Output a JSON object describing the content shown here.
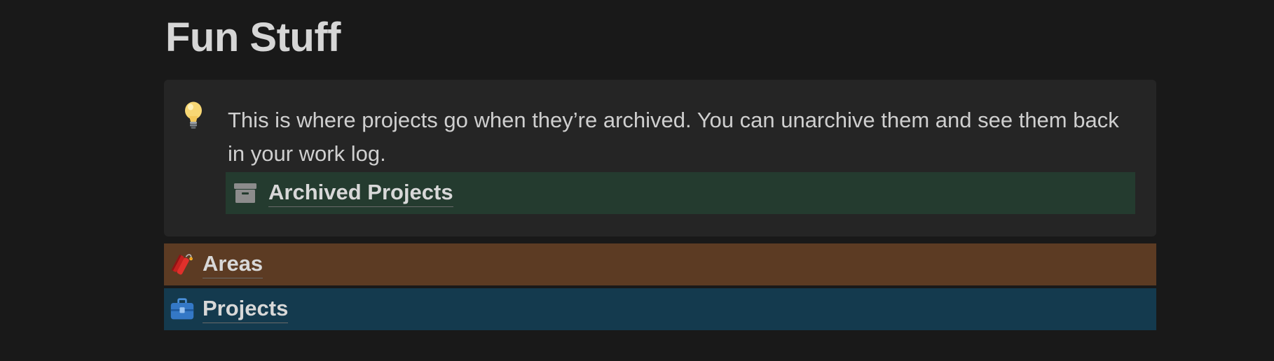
{
  "page": {
    "title": "Fun Stuff"
  },
  "callout": {
    "icon": "lightbulb-icon",
    "text": "This is where projects go when they’re archived. You can unarchive them and see them back in your work log.",
    "background": "#252525"
  },
  "links": {
    "archived": {
      "label": "Archived Projects",
      "icon": "archive-box-icon",
      "background": "#243b2f"
    },
    "areas": {
      "label": "Areas",
      "icon": "dynamite-icon",
      "background": "#5c3b23"
    },
    "projects": {
      "label": "Projects",
      "icon": "briefcase-icon",
      "background": "#143a4e"
    }
  }
}
